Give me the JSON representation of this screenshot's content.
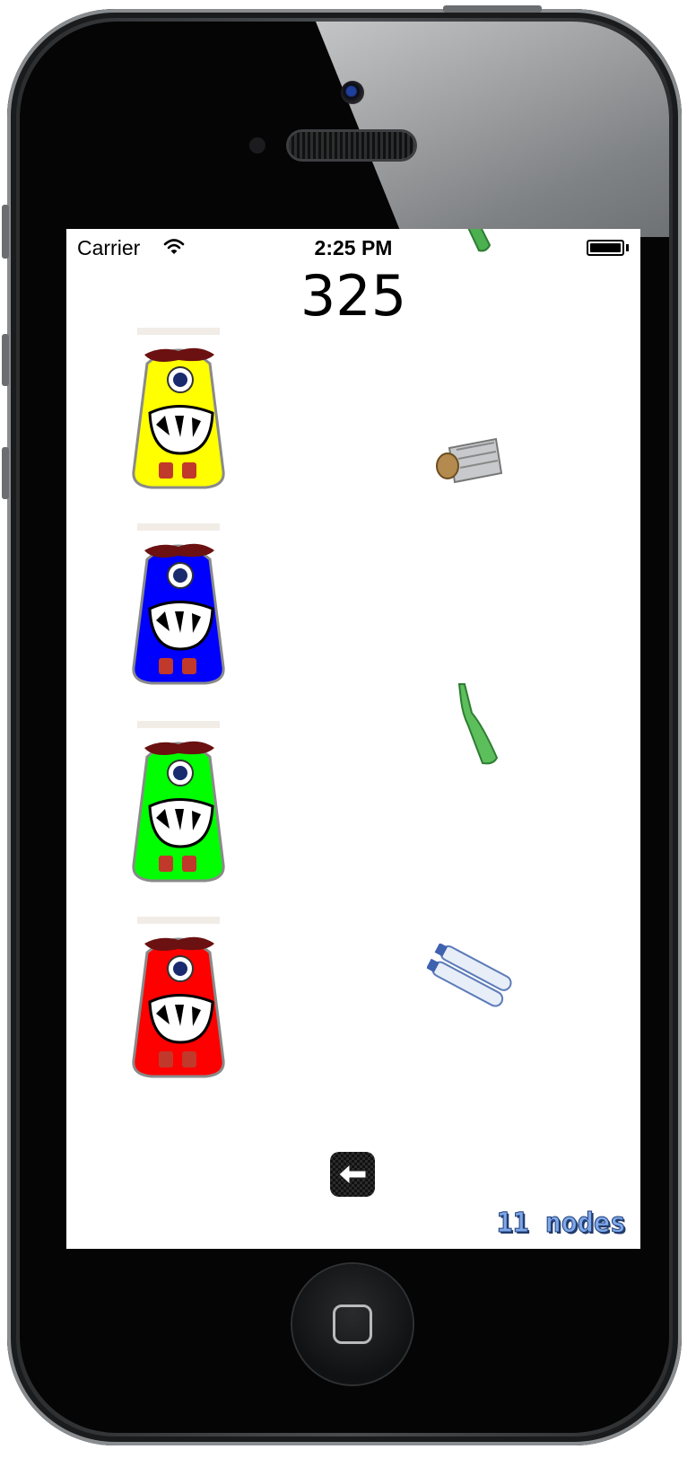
{
  "status_bar": {
    "carrier": "Carrier",
    "time": "2:25 PM",
    "wifi_icon": "wifi-icon",
    "battery_icon": "battery-icon"
  },
  "game": {
    "score": "325",
    "node_count": "11 nodes",
    "back_icon": "arrow-left-icon",
    "monsters": [
      {
        "color_name": "yellow",
        "color": "#ffff00"
      },
      {
        "color_name": "blue",
        "color": "#0000ff"
      },
      {
        "color_name": "green",
        "color": "#00ff00"
      },
      {
        "color_name": "red",
        "color": "#ff0000"
      }
    ],
    "items": [
      {
        "kind": "green-bottle"
      },
      {
        "kind": "tin-can"
      },
      {
        "kind": "green-bottle"
      },
      {
        "kind": "plastic-bottles"
      }
    ]
  }
}
